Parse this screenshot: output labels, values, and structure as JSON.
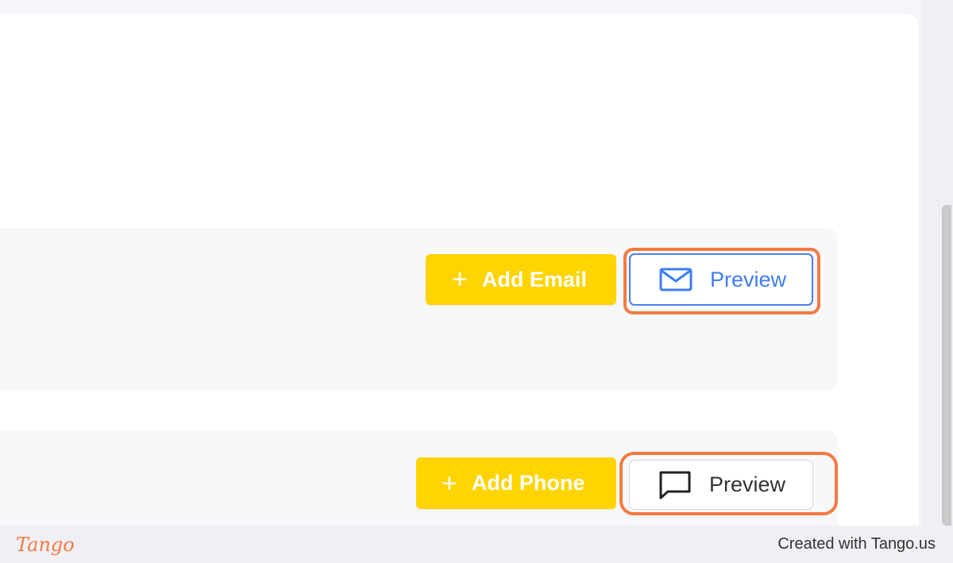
{
  "sections": {
    "email": {
      "add_label": "Add Email",
      "preview_label": "Preview",
      "plus_icon": "+"
    },
    "phone": {
      "add_label": "Add Phone",
      "preview_label": "Preview",
      "plus_icon": "+"
    }
  },
  "footer": {
    "logo_text": "Tango",
    "credit_text": "Created with Tango.us"
  },
  "colors": {
    "accent_yellow": "#ffd400",
    "highlight_orange": "#f47a42",
    "link_blue": "#3d7ef2"
  },
  "icons": {
    "email_preview": "envelope-icon",
    "phone_preview": "chat-bubble-icon"
  }
}
